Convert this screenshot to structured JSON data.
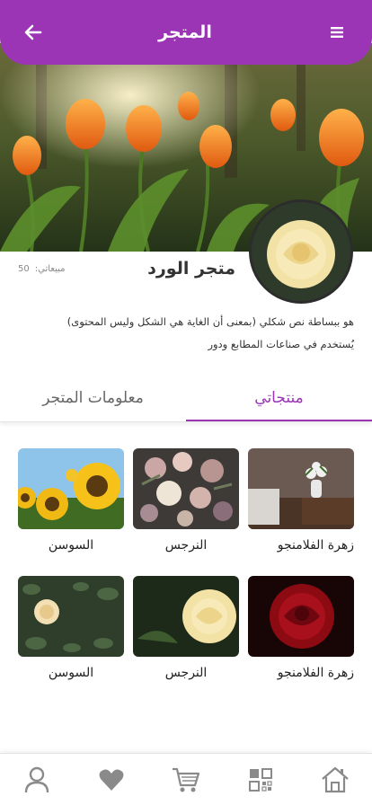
{
  "header": {
    "title": "المتجر",
    "back_icon": "arrow-left-icon",
    "menu_icon": "menu-icon"
  },
  "store": {
    "name": "متجر الورد",
    "sales_label": "مبيعاتي:",
    "sales_count": "50",
    "description_line1": "هو ببساطة نص شكلي (بمعنى أن الغاية هي  الشكل وليس المحتوى)",
    "description_line2": "يُستخدم في صناعات المطابع ودور"
  },
  "tabs": {
    "products": "منتجاتي",
    "store_info": "معلومات المتجر"
  },
  "products": [
    {
      "name": "زهرة الفلامنجو"
    },
    {
      "name": "النرجس"
    },
    {
      "name": "السوسن"
    },
    {
      "name": "زهرة الفلامنجو"
    },
    {
      "name": "النرجس"
    },
    {
      "name": "السوسن"
    }
  ],
  "bottom_nav": [
    "home-icon",
    "qr-code-icon",
    "cart-icon",
    "heart-icon",
    "user-icon"
  ],
  "colors": {
    "accent": "#9b35b5",
    "nav_icon": "#8a8a8a"
  }
}
